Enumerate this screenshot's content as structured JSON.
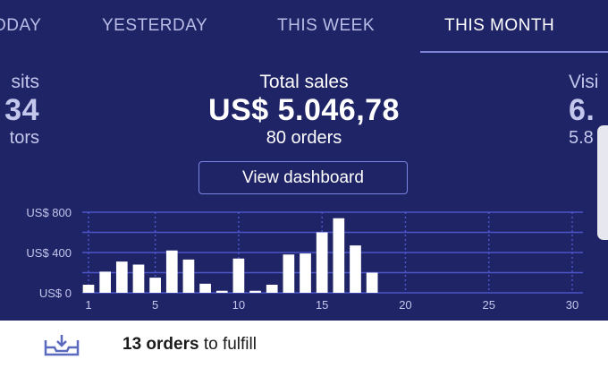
{
  "tabs": [
    {
      "label": "ODAY",
      "active": false
    },
    {
      "label": "YESTERDAY",
      "active": false
    },
    {
      "label": "THIS WEEK",
      "active": false
    },
    {
      "label": "THIS MONTH",
      "active": true
    }
  ],
  "stats": {
    "left": {
      "title": "sits",
      "value": "34",
      "sub": "tors"
    },
    "center": {
      "title": "Total sales",
      "value": "US$ 5.046,78",
      "sub": "80 orders"
    },
    "right": {
      "title": "Visi",
      "value": "6.",
      "sub": "5.8"
    }
  },
  "view_dashboard_label": "View dashboard",
  "chart_data": {
    "type": "bar",
    "y_tick_labels": [
      "US$ 800",
      "US$ 400",
      "US$ 0"
    ],
    "y_ticks": [
      800,
      400,
      0
    ],
    "ylim": [
      0,
      800
    ],
    "x_tick_labels": [
      "1",
      "5",
      "10",
      "15",
      "20",
      "25",
      "30"
    ],
    "x_ticks": [
      1,
      5,
      10,
      15,
      20,
      25,
      30
    ],
    "xlim": [
      1,
      30
    ],
    "categories": [
      1,
      2,
      3,
      4,
      5,
      6,
      7,
      8,
      9,
      10,
      11,
      12,
      13,
      14,
      15,
      16,
      17,
      18,
      19,
      20,
      21,
      22,
      23,
      24,
      25,
      26,
      27,
      28,
      29,
      30
    ],
    "values": [
      80,
      210,
      310,
      280,
      150,
      420,
      330,
      90,
      20,
      340,
      20,
      80,
      380,
      390,
      600,
      740,
      470,
      200,
      0,
      0,
      0,
      0,
      0,
      0,
      0,
      0,
      0,
      0,
      0,
      0
    ],
    "bar_color": "#ffffff",
    "grid": true
  },
  "bottom": {
    "count_text": "13 orders",
    "rest_text": " to fulfill",
    "icon": "inbox-download-icon"
  },
  "colors": {
    "background": "#1f2466",
    "grid": "#4b55c8",
    "accent": "#7c83d6"
  }
}
